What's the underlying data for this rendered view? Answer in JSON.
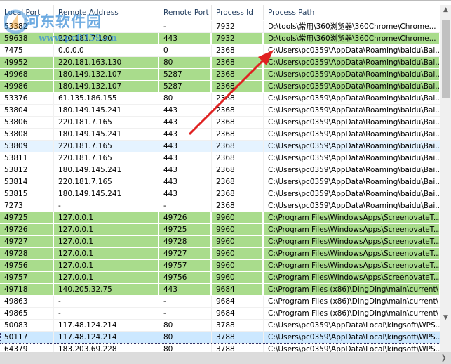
{
  "columns": [
    "Local Port",
    "Remote Address",
    "Remote Port",
    "Process Id",
    "Process Path"
  ],
  "watermark": {
    "title": "河东软件园",
    "url": "www.pc0359.cn"
  },
  "colors": {
    "green": "#a9dc8c",
    "hover": "#e5f3ff",
    "selected": "#cce8ff",
    "arrow": "#e02020"
  },
  "rows": [
    {
      "c": [
        "53382",
        "-",
        "-",
        "7932",
        "D:\\tools\\常用\\360浏览器\\360Chrome\\Chrome..."
      ],
      "s": ""
    },
    {
      "c": [
        "59638",
        "220.181.7.190",
        "443",
        "7932",
        "D:\\tools\\常用\\360浏览器\\360Chrome\\Chrome..."
      ],
      "s": "green"
    },
    {
      "c": [
        "7475",
        "0.0.0.0",
        "0",
        "2368",
        "C:\\Users\\pc0359\\AppData\\Roaming\\baidu\\Bai..."
      ],
      "s": ""
    },
    {
      "c": [
        "49952",
        "220.181.163.130",
        "80",
        "2368",
        "C:\\Users\\pc0359\\AppData\\Roaming\\baidu\\Bai..."
      ],
      "s": "green"
    },
    {
      "c": [
        "49968",
        "180.149.132.107",
        "5287",
        "2368",
        "C:\\Users\\pc0359\\AppData\\Roaming\\baidu\\Bai..."
      ],
      "s": "green"
    },
    {
      "c": [
        "49986",
        "180.149.132.107",
        "5287",
        "2368",
        "C:\\Users\\pc0359\\AppData\\Roaming\\baidu\\Bai..."
      ],
      "s": "green"
    },
    {
      "c": [
        "53376",
        "61.135.186.155",
        "80",
        "2368",
        "C:\\Users\\pc0359\\AppData\\Roaming\\baidu\\Bai..."
      ],
      "s": ""
    },
    {
      "c": [
        "53804",
        "180.149.145.241",
        "443",
        "2368",
        "C:\\Users\\pc0359\\AppData\\Roaming\\baidu\\Bai..."
      ],
      "s": ""
    },
    {
      "c": [
        "53806",
        "220.181.7.165",
        "443",
        "2368",
        "C:\\Users\\pc0359\\AppData\\Roaming\\baidu\\Bai..."
      ],
      "s": ""
    },
    {
      "c": [
        "53808",
        "180.149.145.241",
        "443",
        "2368",
        "C:\\Users\\pc0359\\AppData\\Roaming\\baidu\\Bai..."
      ],
      "s": ""
    },
    {
      "c": [
        "53809",
        "220.181.7.165",
        "443",
        "2368",
        "C:\\Users\\pc0359\\AppData\\Roaming\\baidu\\Bai..."
      ],
      "s": "hover"
    },
    {
      "c": [
        "53811",
        "220.181.7.165",
        "443",
        "2368",
        "C:\\Users\\pc0359\\AppData\\Roaming\\baidu\\Bai..."
      ],
      "s": ""
    },
    {
      "c": [
        "53812",
        "180.149.145.241",
        "443",
        "2368",
        "C:\\Users\\pc0359\\AppData\\Roaming\\baidu\\Bai..."
      ],
      "s": ""
    },
    {
      "c": [
        "53814",
        "220.181.7.165",
        "443",
        "2368",
        "C:\\Users\\pc0359\\AppData\\Roaming\\baidu\\Bai..."
      ],
      "s": ""
    },
    {
      "c": [
        "53815",
        "180.149.145.241",
        "443",
        "2368",
        "C:\\Users\\pc0359\\AppData\\Roaming\\baidu\\Bai..."
      ],
      "s": ""
    },
    {
      "c": [
        "7273",
        "-",
        "-",
        "2368",
        "C:\\Users\\pc0359\\AppData\\Roaming\\baidu\\Bai..."
      ],
      "s": ""
    },
    {
      "c": [
        "49725",
        "127.0.0.1",
        "49726",
        "9960",
        "C:\\Program Files\\WindowsApps\\ScreenovateT..."
      ],
      "s": "green"
    },
    {
      "c": [
        "49726",
        "127.0.0.1",
        "49725",
        "9960",
        "C:\\Program Files\\WindowsApps\\ScreenovateT..."
      ],
      "s": "green"
    },
    {
      "c": [
        "49727",
        "127.0.0.1",
        "49728",
        "9960",
        "C:\\Program Files\\WindowsApps\\ScreenovateT..."
      ],
      "s": "green"
    },
    {
      "c": [
        "49728",
        "127.0.0.1",
        "49727",
        "9960",
        "C:\\Program Files\\WindowsApps\\ScreenovateT..."
      ],
      "s": "green"
    },
    {
      "c": [
        "49756",
        "127.0.0.1",
        "49757",
        "9960",
        "C:\\Program Files\\WindowsApps\\ScreenovateT..."
      ],
      "s": "green"
    },
    {
      "c": [
        "49757",
        "127.0.0.1",
        "49756",
        "9960",
        "C:\\Program Files\\WindowsApps\\ScreenovateT..."
      ],
      "s": "green"
    },
    {
      "c": [
        "49718",
        "140.205.32.75",
        "443",
        "9684",
        "C:\\Program Files (x86)\\DingDing\\main\\current\\"
      ],
      "s": "green"
    },
    {
      "c": [
        "49863",
        "-",
        "-",
        "9684",
        "C:\\Program Files (x86)\\DingDing\\main\\current\\"
      ],
      "s": ""
    },
    {
      "c": [
        "49865",
        "-",
        "-",
        "9684",
        "C:\\Program Files (x86)\\DingDing\\main\\current\\"
      ],
      "s": ""
    },
    {
      "c": [
        "50083",
        "117.48.124.214",
        "80",
        "3788",
        "C:\\Users\\pc0359\\AppData\\Local\\kingsoft\\WPS..."
      ],
      "s": ""
    },
    {
      "c": [
        "50117",
        "117.48.124.214",
        "80",
        "3788",
        "C:\\Users\\pc0359\\AppData\\Local\\kingsoft\\WPS..."
      ],
      "s": "sel"
    },
    {
      "c": [
        "64379",
        "183.203.69.228",
        "80",
        "3788",
        "C:\\Users\\pc0359\\AppData\\Local\\kingsoft\\WPS..."
      ],
      "s": ""
    }
  ]
}
